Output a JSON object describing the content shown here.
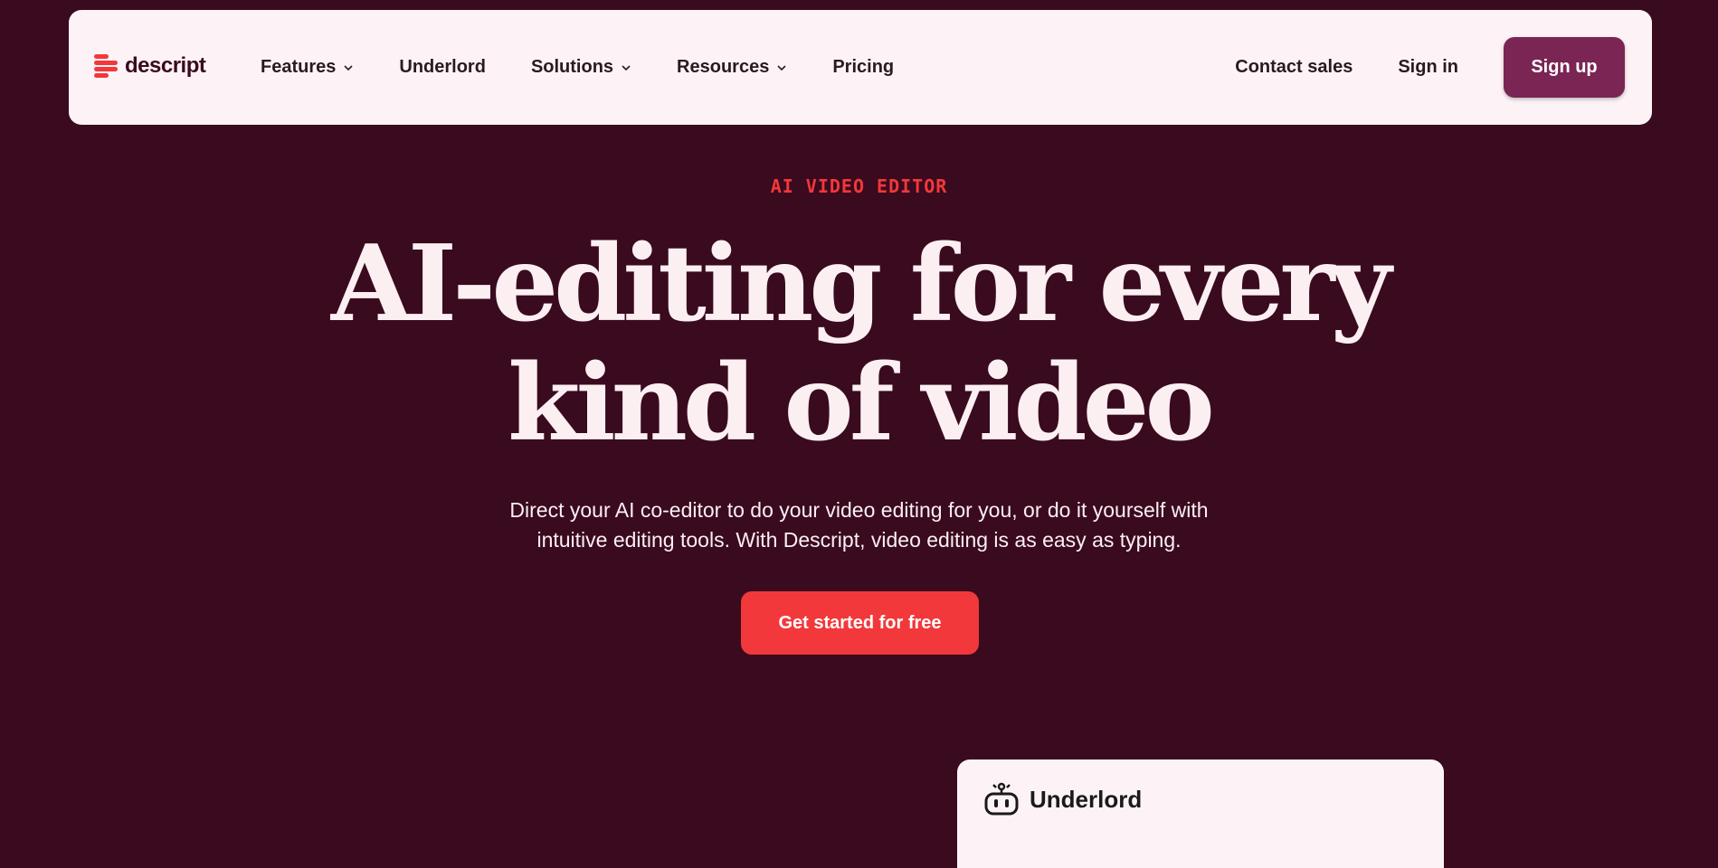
{
  "brand": {
    "name": "descript",
    "accent": "#f2383a",
    "background": "#3a0a1f"
  },
  "nav": {
    "links": [
      {
        "label": "Features",
        "has_dropdown": true
      },
      {
        "label": "Underlord",
        "has_dropdown": false
      },
      {
        "label": "Solutions",
        "has_dropdown": true
      },
      {
        "label": "Resources",
        "has_dropdown": true
      },
      {
        "label": "Pricing",
        "has_dropdown": false
      }
    ],
    "contact_sales": "Contact sales",
    "sign_in": "Sign in",
    "sign_up": "Sign up",
    "sign_up_color": "#7a2553"
  },
  "hero": {
    "eyebrow": "AI VIDEO EDITOR",
    "headline_line1": "AI-editing for every",
    "headline_line2": "kind of video",
    "subtitle_line1": "Direct your AI co-editor to do your video editing for you, or do it yourself with",
    "subtitle_line2": "intuitive editing tools. With Descript, video editing is as easy as typing.",
    "cta": "Get started for free"
  },
  "card": {
    "title": "Underlord",
    "icon": "robot-icon"
  }
}
